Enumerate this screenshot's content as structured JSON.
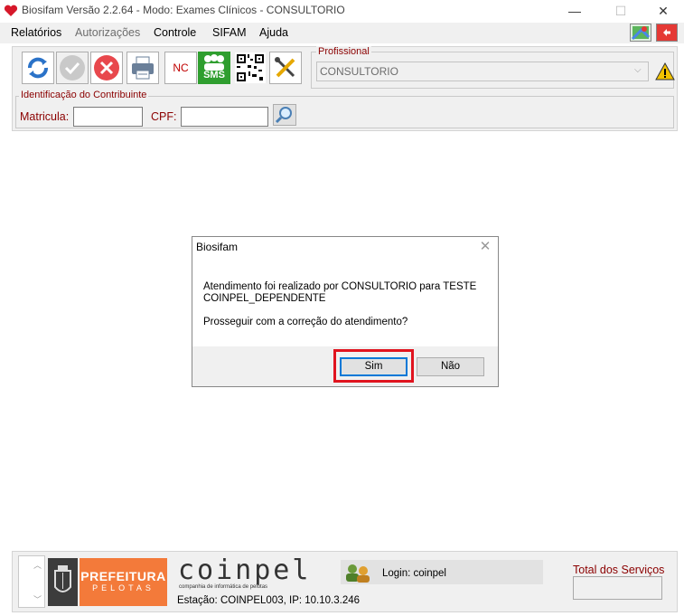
{
  "window": {
    "title": "Biosifam Versão 2.2.64 - Modo: Exames Clínicos - CONSULTORIO",
    "minimize_glyph": "—",
    "maximize_glyph": "☐",
    "close_glyph": "✕"
  },
  "menu": {
    "items": [
      "Relatórios",
      "Autorizações",
      "Controle",
      "SIFAM",
      "Ajuda"
    ],
    "disabled": [
      "Autorizações"
    ]
  },
  "toolbar": {
    "buttons": [
      {
        "icon": "refresh-icon"
      },
      {
        "icon": "check-icon"
      },
      {
        "icon": "cancel-icon"
      },
      {
        "icon": "printer-icon"
      },
      {
        "icon": "nc-icon",
        "label": "NC"
      },
      {
        "icon": "sms-icon",
        "label": "SMS"
      },
      {
        "icon": "qrcode-icon"
      },
      {
        "icon": "tools-icon"
      }
    ]
  },
  "profissional": {
    "legend": "Profissional",
    "selected": "CONSULTORIO"
  },
  "contribuinte": {
    "legend": "Identificação do Contribuinte",
    "matricula_label": "Matricula:",
    "cpf_label": "CPF:",
    "matricula_value": "",
    "cpf_value": ""
  },
  "dialog": {
    "title": "Biosifam",
    "close_glyph": "✕",
    "message_line1": "Atendimento foi realizado por CONSULTORIO para TESTE",
    "message_line2": "COINPEL_DEPENDENTE",
    "question": "Prosseguir com a correção do atendimento?",
    "yes_label": "Sim",
    "no_label": "Não"
  },
  "status": {
    "prefeitura_line1": "PREFEITURA",
    "prefeitura_line2": "PELOTAS",
    "company_name": "coinpel",
    "company_tagline": "companhia de informática de pelotas",
    "login_text": "Login: coinpel",
    "station_text": "Estação: COINPEL003, IP: 10.10.3.246",
    "total_label": "Total dos Serviços",
    "total_value": ""
  },
  "colors": {
    "accent_red": "#8b0000",
    "highlight": "#e0141f",
    "prefeitura_orange": "#f37a3a",
    "sms_green": "#2f9e2f"
  }
}
